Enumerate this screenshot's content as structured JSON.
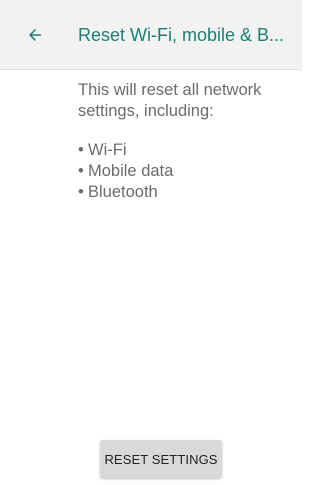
{
  "header": {
    "title": "Reset Wi-Fi, mobile & B..."
  },
  "content": {
    "description": "This will reset all network settings, including:",
    "items": [
      {
        "bullet": "•",
        "label": "Wi-Fi"
      },
      {
        "bullet": "•",
        "label": "Mobile data"
      },
      {
        "bullet": "•",
        "label": "Bluetooth"
      }
    ]
  },
  "actions": {
    "reset_label": "RESET SETTINGS"
  },
  "icons": {
    "back": "arrow-left-icon"
  },
  "colors": {
    "accent": "#1d7f74",
    "appbar_bg": "#f2f2f2",
    "button_bg": "#d9d9d9",
    "body_text": "#6b6b6b"
  }
}
